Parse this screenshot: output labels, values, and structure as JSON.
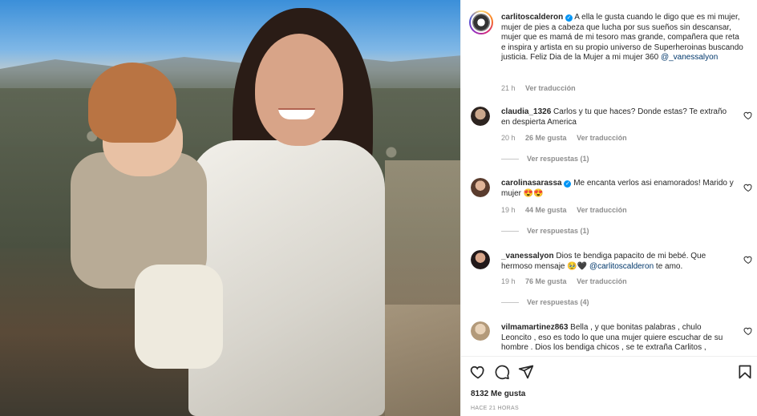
{
  "post": {
    "author": "carlitoscalderon",
    "caption_text": "A ella le gusta cuando le digo que es mi mujer, mujer de pies a cabeza que lucha por sus sueños sin descansar, mujer que es mamá de mi tesoro mas grande, compañera que reta e inspira y artista en su propio universo de Superheroinas buscando justicia. Feliz Dia de la Mujer a mi mujer 360",
    "caption_mention": "@_vanessalyon",
    "time": "21 h",
    "see_translation": "Ver traducción"
  },
  "comments": [
    {
      "user": "claudia_1326",
      "verified": false,
      "text": "Carlos y tu que haces? Donde estas? Te extraño en despierta America",
      "time": "20 h",
      "likes": "26 Me gusta",
      "translate": "Ver traducción",
      "replies": "Ver respuestas (1)"
    },
    {
      "user": "carolinasarassa",
      "verified": true,
      "text": "Me encanta verlos asi enamorados! Marido y mujer 😍😍",
      "time": "19 h",
      "likes": "44 Me gusta",
      "translate": "Ver traducción",
      "replies": "Ver respuestas (1)"
    },
    {
      "user": "_vanessalyon",
      "verified": false,
      "text_before": "Dios te bendiga papacito de mi bebé. Que hermoso mensaje 🥹🖤",
      "mention": "@carlitoscalderon",
      "text_after": "te amo.",
      "time": "19 h",
      "likes": "76 Me gusta",
      "translate": "Ver traducción",
      "replies": "Ver respuestas (4)"
    },
    {
      "user": "vilmamartinez863",
      "verified": false,
      "text": "Bella , y que bonitas palabras , chulo Leoncito , eso es todo lo que una mujer quiere escuchar de su hombre . Dios los bendiga chicos , se te extraña Carlitos ,"
    }
  ],
  "footer": {
    "likes": "8132 Me gusta",
    "time": "HACE 21 HORAS"
  },
  "icons": {
    "like": "heart-icon",
    "comment": "comment-icon",
    "share": "send-icon",
    "save": "bookmark-icon"
  },
  "colors": {
    "verified": "#0095f6",
    "link": "#00376b",
    "muted": "#8e8e8e"
  }
}
